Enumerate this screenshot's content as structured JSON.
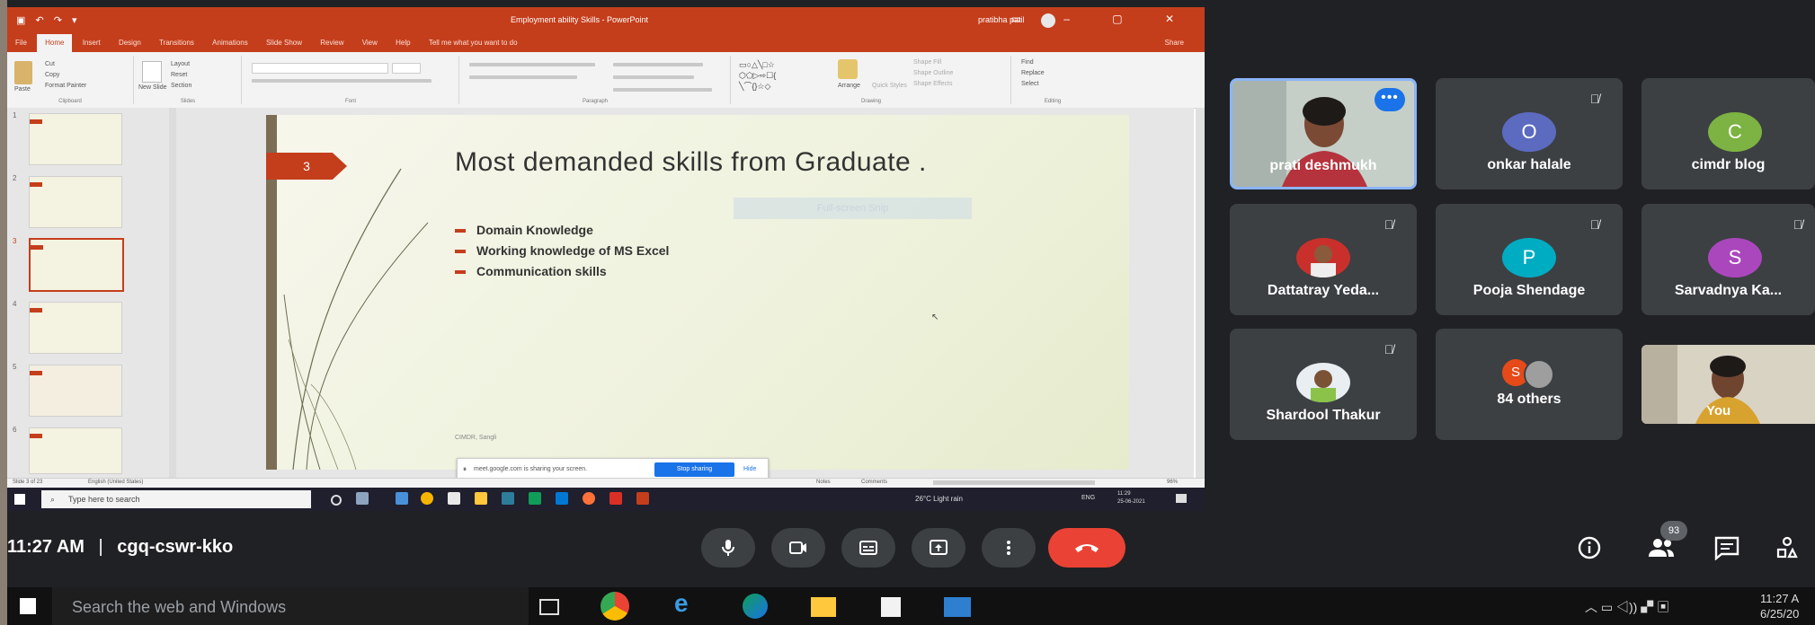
{
  "powerpoint": {
    "document_title": "Employment ability Skills - PowerPoint",
    "user_name": "pratibha patil",
    "tabs": [
      "File",
      "Home",
      "Insert",
      "Design",
      "Transitions",
      "Animations",
      "Slide Show",
      "Review",
      "View",
      "Help"
    ],
    "tell_me": "Tell me what you want to do",
    "share": "Share",
    "ribbon_groups": [
      "Clipboard",
      "Slides",
      "Font",
      "Paragraph",
      "Drawing",
      "Editing"
    ],
    "clipboard": {
      "paste": "Paste",
      "cut": "Cut",
      "copy": "Copy",
      "format_painter": "Format Painter"
    },
    "slides_group": {
      "new_slide": "New Slide",
      "layout": "Layout",
      "reset": "Reset",
      "section": "Section"
    },
    "drawing": {
      "arrange": "Arrange",
      "quick_styles": "Quick Styles",
      "shape_fill": "Shape Fill",
      "shape_outline": "Shape Outline",
      "shape_effects": "Shape Effects"
    },
    "editing": {
      "find": "Find",
      "replace": "Replace",
      "select": "Select"
    },
    "thumbnails": [
      {
        "num": "1"
      },
      {
        "num": "2"
      },
      {
        "num": "3",
        "selected": true
      },
      {
        "num": "4"
      },
      {
        "num": "5"
      },
      {
        "num": "6"
      }
    ],
    "slide": {
      "number": "3",
      "title": "Most demanded skills from Graduate .",
      "bullets": [
        "Domain Knowledge",
        "Working knowledge of MS Excel",
        "Communication skills"
      ],
      "footer": "CIMDR, Sangli",
      "snip_overlay": "Full-screen Snip"
    },
    "sharing_bar": {
      "text": "meet.google.com is sharing your screen.",
      "stop_button": "Stop sharing",
      "hide_link": "Hide"
    },
    "status": {
      "slide_info": "Slide 3 of 23",
      "language": "English (United States)",
      "notes": "Notes",
      "comments": "Comments",
      "zoom": "96%"
    },
    "taskbar": {
      "search_placeholder": "Type here to search",
      "weather": "26°C Light rain",
      "lang": "ENG",
      "time": "11:29",
      "date": "25-06-2021"
    }
  },
  "participants": [
    {
      "name": "prati deshmukh",
      "kind": "video",
      "active": true
    },
    {
      "name": "onkar halale",
      "initial": "O",
      "color": "#5c6bc0",
      "muted": true
    },
    {
      "name": "cimdr blog",
      "initial": "C",
      "color": "#7cb342",
      "muted": false
    },
    {
      "name": "Dattatray Yeda...",
      "kind": "photo",
      "muted": true
    },
    {
      "name": "Pooja Shendage",
      "initial": "P",
      "color": "#00acc1",
      "muted": true
    },
    {
      "name": "Sarvadnya Ka...",
      "initial": "S",
      "color": "#ab47bc",
      "muted": true
    },
    {
      "name": "Shardool Thakur",
      "kind": "photo",
      "muted": true
    },
    {
      "name": "84 others",
      "initial": "S",
      "color": "#e64a19"
    },
    {
      "name": "You",
      "kind": "video"
    }
  ],
  "meeting": {
    "time": "11:27 AM",
    "separator": "|",
    "code": "cgq-cswr-kko",
    "participant_count": "93"
  },
  "os_taskbar": {
    "search_placeholder": "Search the web and Windows",
    "time": "11:27 A",
    "date": "6/25/20"
  }
}
